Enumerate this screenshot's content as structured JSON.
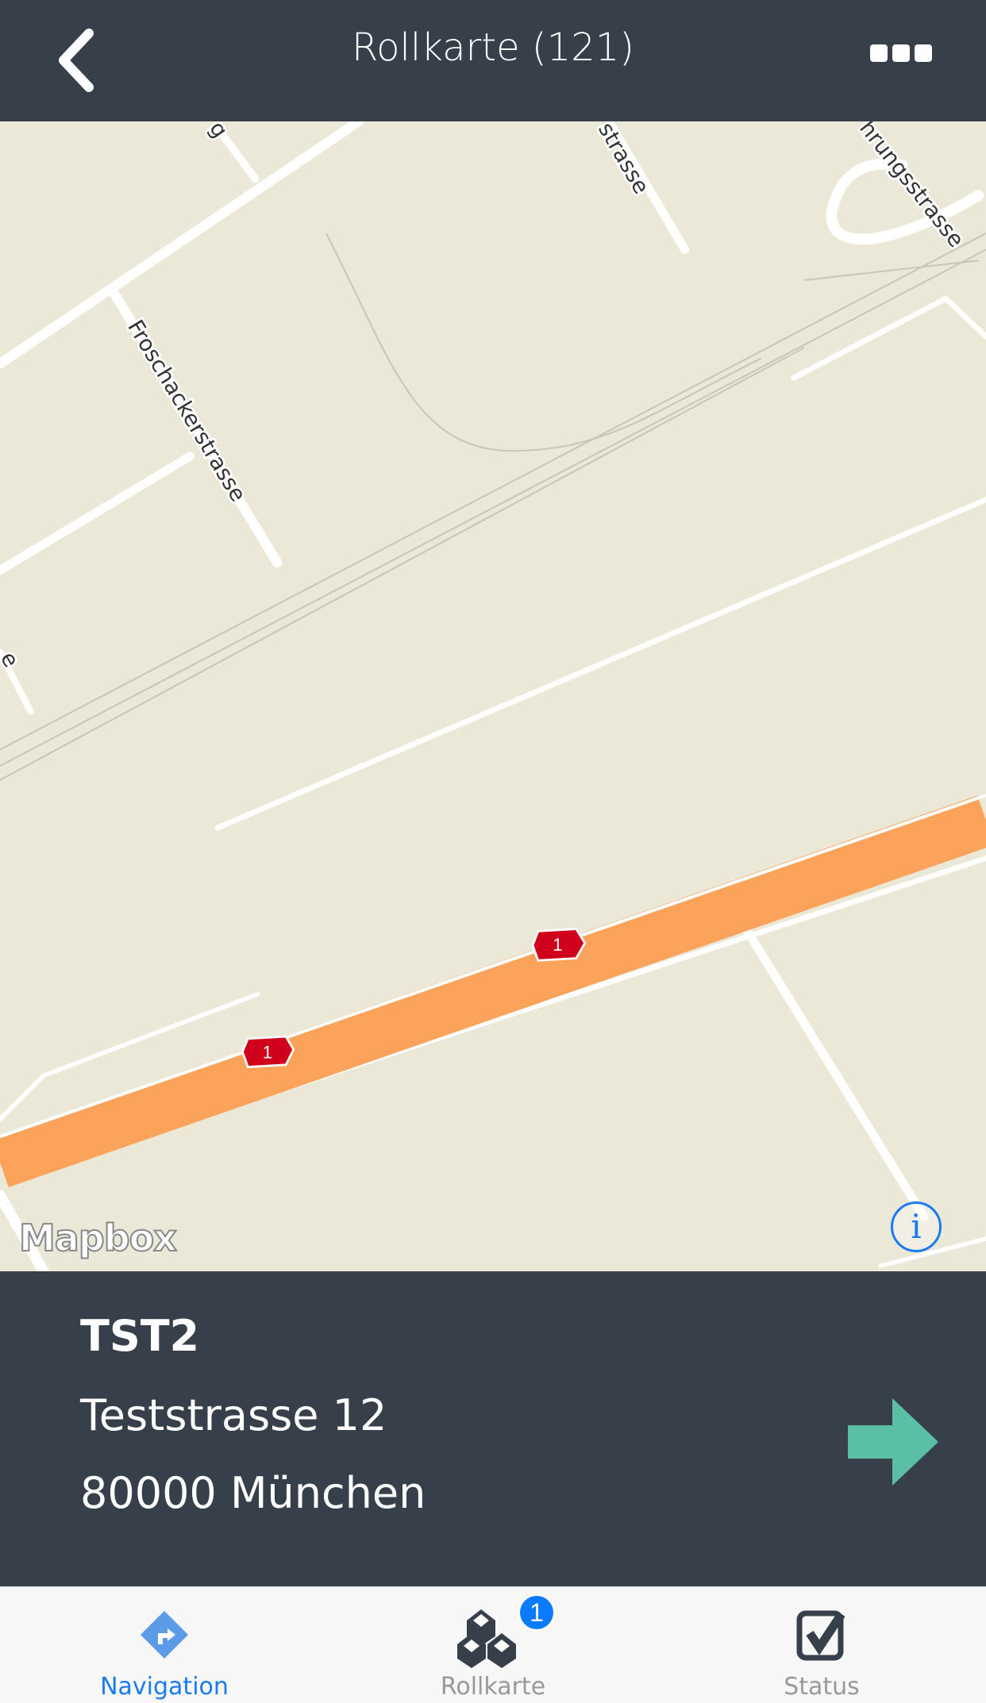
{
  "header": {
    "title": "Rollkarte (121)",
    "back_icon": "chevron-left-icon",
    "more_icon": "more-dots-icon"
  },
  "map": {
    "streets": [
      "Froschackerstrasse",
      "strasse",
      "hrungsstrasse",
      "g",
      "e"
    ],
    "shields": [
      "1",
      "1"
    ],
    "attribution_logo": "Mapbox",
    "info_label": "i",
    "colors": {
      "background": "#ebe8d8",
      "motorway": "#fba35b",
      "shield": "#d0021b"
    }
  },
  "stop": {
    "code": "TST2",
    "street": "Teststrasse 12",
    "city": "80000 München",
    "go_icon": "arrow-right-icon",
    "go_color": "#5bbfa6"
  },
  "tabs": [
    {
      "label": "Navigation",
      "icon": "navigation-diamond-icon",
      "active": true
    },
    {
      "label": "Rollkarte",
      "icon": "boxes-icon",
      "badge": "1"
    },
    {
      "label": "Status",
      "icon": "checkbox-checked-icon"
    }
  ],
  "colors": {
    "header": "#373f4a",
    "accent": "#1a7bf0"
  }
}
